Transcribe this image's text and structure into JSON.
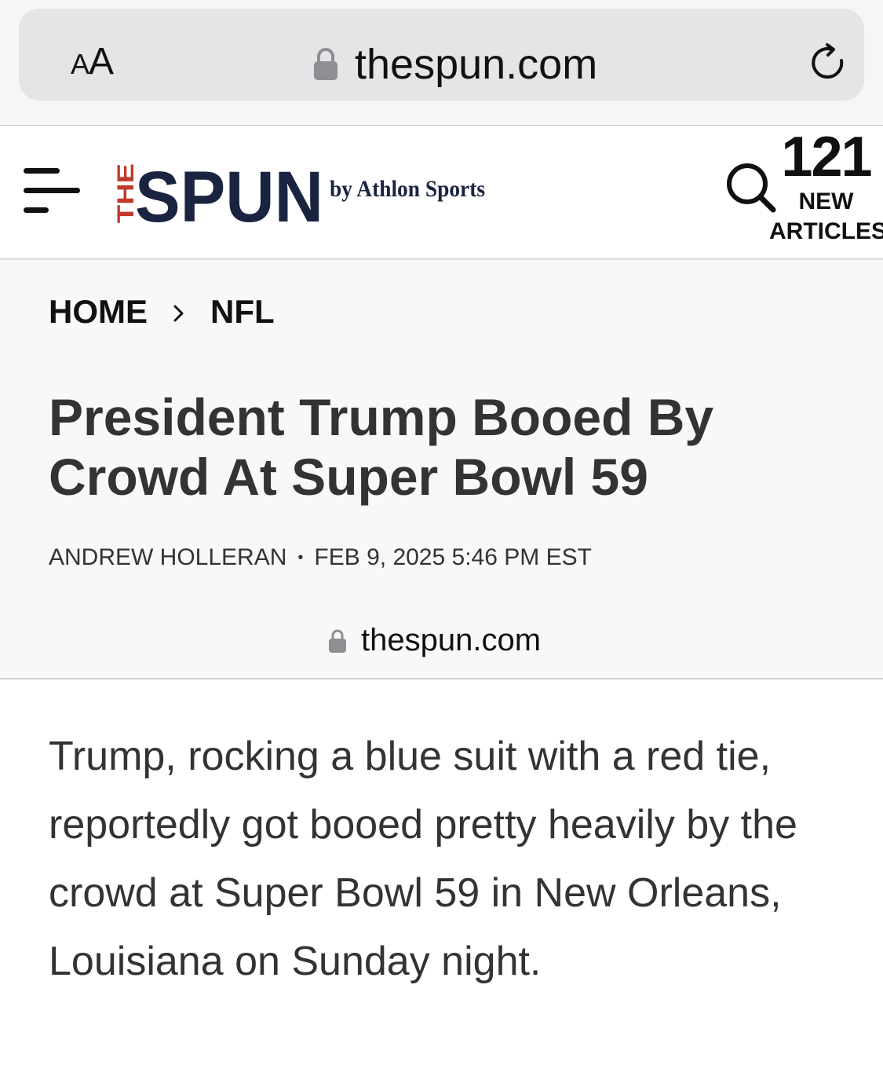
{
  "browser": {
    "aa_small": "A",
    "aa_large": "A",
    "host": "thespun.com"
  },
  "header": {
    "logo_the": "THE",
    "logo_spun": "SPUN",
    "logo_by": "by Athlon Sports",
    "new_count": "121",
    "new_label_1": "NEW",
    "new_label_2": "ARTICLES",
    "brand_colors": {
      "red": "#c0392b",
      "navy": "#1a2340"
    }
  },
  "breadcrumb": {
    "home": "HOME",
    "section": "NFL"
  },
  "article": {
    "title": "President Trump Booed By Crowd At Super Bowl 59",
    "author": "ANDREW HOLLERAN",
    "separator": "•",
    "date": "FEB 9, 2025 5:46 PM EST",
    "footer_host": "thespun.com",
    "body": "Trump, rocking a blue suit with a red tie, reportedly got booed pretty heavily by the crowd at Super Bowl 59 in New Orleans, Louisiana on Sunday night."
  },
  "icons": [
    "text-size-icon",
    "lock-icon",
    "reload-icon",
    "menu-icon",
    "search-icon",
    "chevron-right-icon"
  ]
}
